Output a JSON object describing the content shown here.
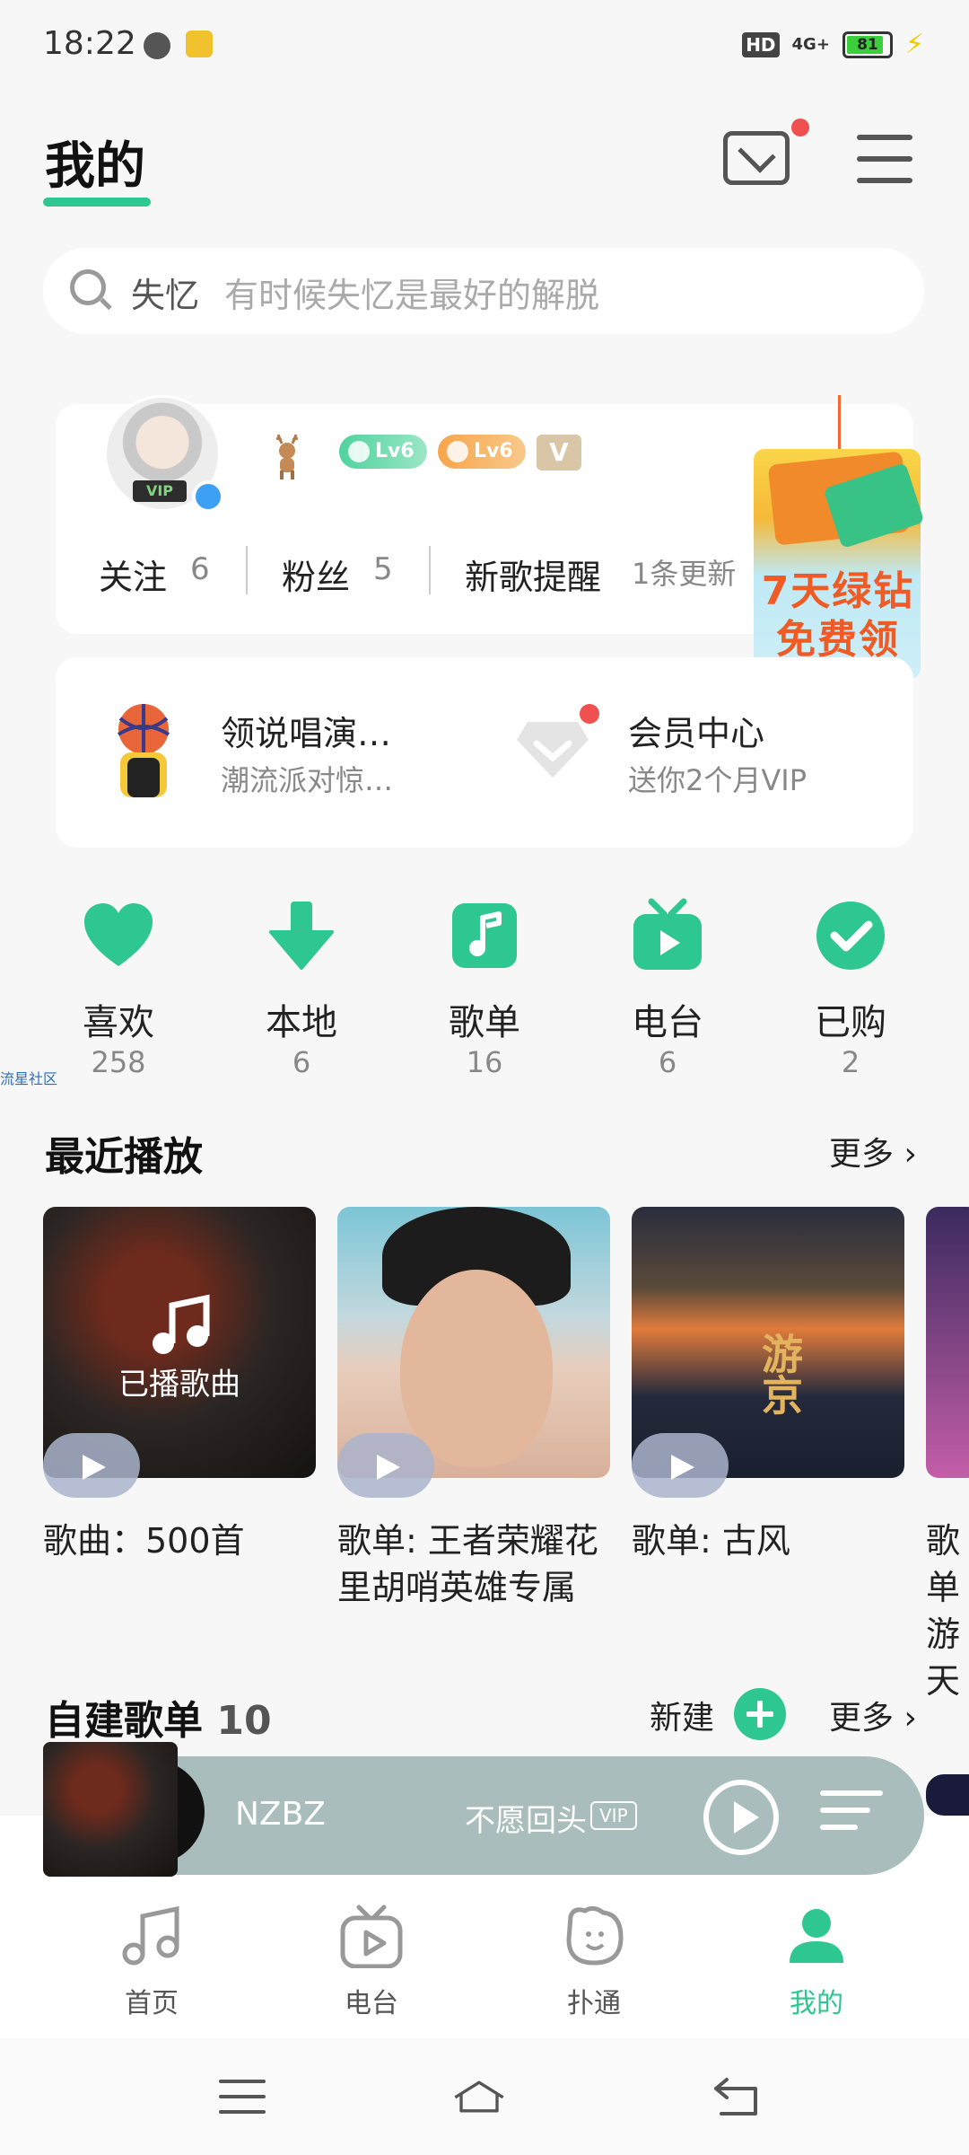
{
  "status_bar": {
    "time": "18:22",
    "hd": "HD",
    "signal": "4G+",
    "battery": "81"
  },
  "header": {
    "title": "我的"
  },
  "search": {
    "keyword": "失忆",
    "hint": "有时候失忆是最好的解脱"
  },
  "profile": {
    "vip_tag": "VIP",
    "level_green": "Lv6",
    "level_orange": "Lv6",
    "v_badge": "V",
    "stats": [
      {
        "label": "关注",
        "value": "6"
      },
      {
        "label": "粉丝",
        "value": "5"
      },
      {
        "label": "新歌提醒",
        "value": "1条更新"
      }
    ]
  },
  "promo": {
    "text_line1": "7天绿钻",
    "text_line2": "免费领"
  },
  "features": {
    "performance": {
      "title": "领说唱演…",
      "subtitle": "潮流派对惊…"
    },
    "vip_center": {
      "title": "会员中心",
      "subtitle": "送你2个月VIP"
    }
  },
  "quick_entries": [
    {
      "label": "喜欢",
      "count": "258",
      "icon": "heart-icon"
    },
    {
      "label": "本地",
      "count": "6",
      "icon": "download-icon"
    },
    {
      "label": "歌单",
      "count": "16",
      "icon": "playlist-icon"
    },
    {
      "label": "电台",
      "count": "6",
      "icon": "radio-icon"
    },
    {
      "label": "已购",
      "count": "2",
      "icon": "purchased-icon"
    }
  ],
  "community_tag": "流星社区",
  "recent": {
    "title": "最近播放",
    "more": "更多",
    "items": [
      {
        "overlay": "已播歌曲",
        "caption": "歌曲：500首"
      },
      {
        "caption": "歌单: 王者荣耀花里胡哨英雄专属"
      },
      {
        "cover_text": "游京",
        "caption": "歌单: 古风"
      },
      {
        "caption": "歌单 游天"
      }
    ]
  },
  "playlists": {
    "title": "自建歌单",
    "count": "10",
    "new_label": "新建",
    "more": "更多"
  },
  "mini_player": {
    "artist": "NZBZ",
    "song": "不愿回头",
    "vip": "VIP"
  },
  "bottom_nav": [
    {
      "label": "首页"
    },
    {
      "label": "电台"
    },
    {
      "label": "扑通"
    },
    {
      "label": "我的"
    }
  ],
  "colors": {
    "accent": "#2ec691",
    "badge_red": "#f05050"
  }
}
